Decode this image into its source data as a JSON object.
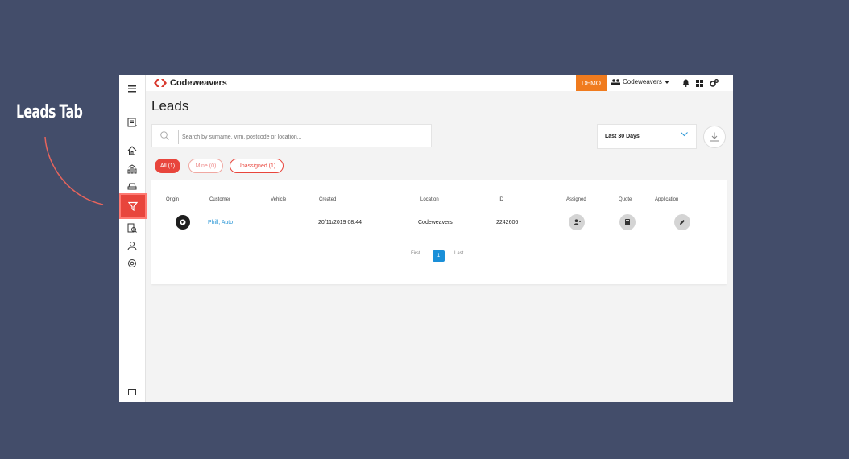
{
  "annotation": {
    "label": "Leads Tab"
  },
  "app": {
    "logo_text": "Codeweavers",
    "env_badge": "DEMO",
    "account_name": "Codeweavers",
    "page_title": "Leads"
  },
  "search": {
    "placeholder": "Search by surname, vrm, postcode or location..."
  },
  "date_range": {
    "value": "Last 30 Days"
  },
  "filters": [
    {
      "label": "All (1)"
    },
    {
      "label": "Mine (0)"
    },
    {
      "label": "Unassigned (1)"
    }
  ],
  "table": {
    "headers": [
      "Origin",
      "Customer",
      "Vehicle",
      "Created",
      "Location",
      "ID",
      "Assigned",
      "Quote",
      "Application"
    ],
    "rows": [
      {
        "customer": "Phill, Auto",
        "vehicle": "",
        "created": "20/11/2019 08:44",
        "location": "Codeweavers",
        "id": "2242606"
      }
    ]
  },
  "pagination": {
    "first": "First",
    "current": "1",
    "last": "Last"
  },
  "colors": {
    "accent": "#e8453c",
    "badge": "#f07b1e",
    "link": "#2a96d6",
    "background": "#434d6a"
  }
}
